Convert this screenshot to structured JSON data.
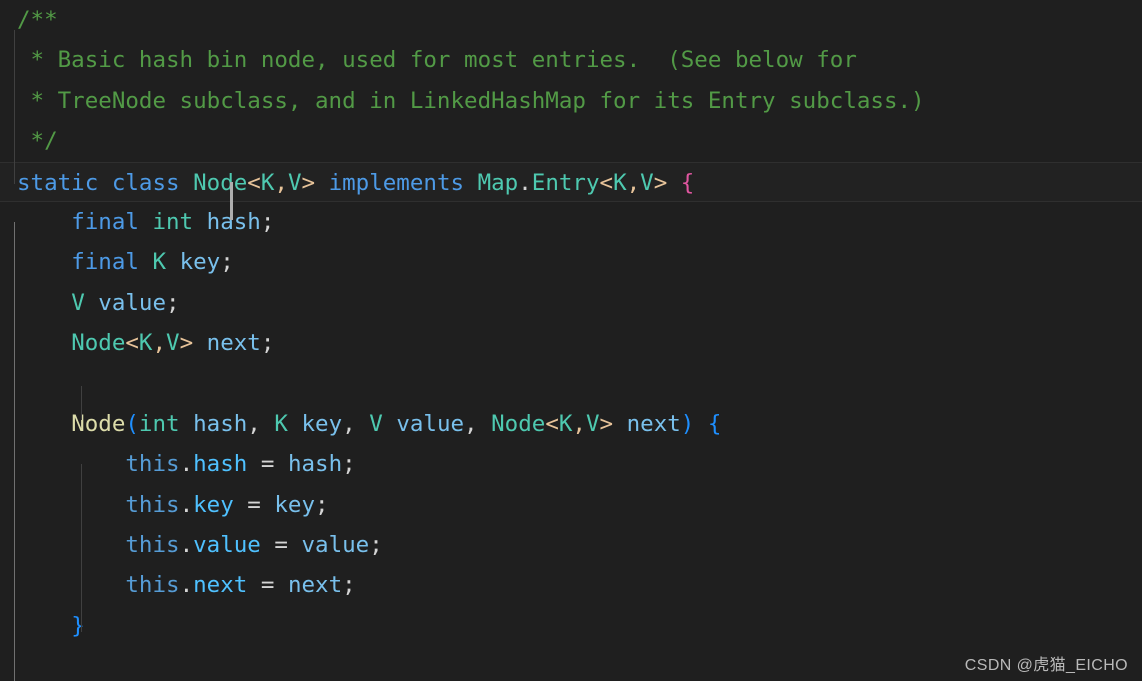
{
  "editor": {
    "language": "java",
    "background_color": "#1f1f1f",
    "current_line_color": "#222222",
    "caret_color": "#aeaeae",
    "font_size_px": 22.5,
    "line_height_px": 40.4,
    "cursor": {
      "line": 5,
      "column": 14
    }
  },
  "colors": {
    "comment": "#529a46",
    "keyword": "#4d9ae6",
    "type": "#4ec9b0",
    "variable": "#79c0ec",
    "property": "#4fc1ff",
    "this_keyword": "#569cd6",
    "function": "#dcdcaa",
    "punctuation": "#d4d4d4",
    "angle_bracket": "#e8c49a",
    "bracket_level_1": "#e056a0",
    "bracket_level_2": "#1e8fff"
  },
  "code": {
    "lines": [
      {
        "n": 1,
        "text": "/**"
      },
      {
        "n": 2,
        "text": " * Basic hash bin node, used for most entries.  (See below for"
      },
      {
        "n": 3,
        "text": " * TreeNode subclass, and in LinkedHashMap for its Entry subclass.)"
      },
      {
        "n": 4,
        "text": " */"
      },
      {
        "n": 5,
        "text": "static class Node<K,V> implements Map.Entry<K,V> {"
      },
      {
        "n": 6,
        "text": "    final int hash;"
      },
      {
        "n": 7,
        "text": "    final K key;"
      },
      {
        "n": 8,
        "text": "    V value;"
      },
      {
        "n": 9,
        "text": "    Node<K,V> next;"
      },
      {
        "n": 10,
        "text": ""
      },
      {
        "n": 11,
        "text": "    Node(int hash, K key, V value, Node<K,V> next) {"
      },
      {
        "n": 12,
        "text": "        this.hash = hash;"
      },
      {
        "n": 13,
        "text": "        this.key = key;"
      },
      {
        "n": 14,
        "text": "        this.value = value;"
      },
      {
        "n": 15,
        "text": "        this.next = next;"
      },
      {
        "n": 16,
        "text": "    }"
      }
    ],
    "tokens": {
      "l1_comment": "/**",
      "l2_comment": " * Basic hash bin node, used for most entries.  (See below for",
      "l3_comment": " * TreeNode subclass, and in LinkedHashMap for its Entry subclass.)",
      "l4_comment": " */",
      "l5_static": "static",
      "l5_class": "class",
      "l5_node": "Node",
      "l5_lt": "<",
      "l5_k": "K",
      "l5_comma": ",",
      "l5_v": "V",
      "l5_gt": ">",
      "l5_implements": "implements",
      "l5_map": "Map",
      "l5_dot": ".",
      "l5_entry": "Entry",
      "l5_lt2": "<",
      "l5_k2": "K",
      "l5_comma2": ",",
      "l5_v2": "V",
      "l5_gt2": ">",
      "l5_brace": "{",
      "l6_final": "final",
      "l6_int": "int",
      "l6_hash": "hash",
      "l6_semi": ";",
      "l7_final": "final",
      "l7_k": "K",
      "l7_key": "key",
      "l7_semi": ";",
      "l8_v": "V",
      "l8_value": "value",
      "l8_semi": ";",
      "l9_node": "Node",
      "l9_lt": "<",
      "l9_k": "K",
      "l9_comma": ",",
      "l9_v": "V",
      "l9_gt": ">",
      "l9_next": "next",
      "l9_semi": ";",
      "l11_node": "Node",
      "l11_lparen": "(",
      "l11_int": "int",
      "l11_hash": "hash",
      "l11_c1": ",",
      "l11_k": "K",
      "l11_key": "key",
      "l11_c2": ",",
      "l11_v": "V",
      "l11_value": "value",
      "l11_c3": ",",
      "l11_node2": "Node",
      "l11_lt": "<",
      "l11_k2": "K",
      "l11_c4": ",",
      "l11_v2": "V",
      "l11_gt": ">",
      "l11_next": "next",
      "l11_rparen": ")",
      "l11_brace": "{",
      "l12_this": "this",
      "l12_dot": ".",
      "l12_prop": "hash",
      "l12_eq": "=",
      "l12_val": "hash",
      "l12_semi": ";",
      "l13_this": "this",
      "l13_dot": ".",
      "l13_prop": "key",
      "l13_eq": "=",
      "l13_val": "key",
      "l13_semi": ";",
      "l14_this": "this",
      "l14_dot": ".",
      "l14_prop": "value",
      "l14_eq": "=",
      "l14_val": "value",
      "l14_semi": ";",
      "l15_this": "this",
      "l15_dot": ".",
      "l15_prop": "next",
      "l15_eq": "=",
      "l15_val": "next",
      "l15_semi": ";",
      "l16_brace": "}"
    }
  },
  "watermark": {
    "text": "CSDN @虎猫_EICHO"
  }
}
